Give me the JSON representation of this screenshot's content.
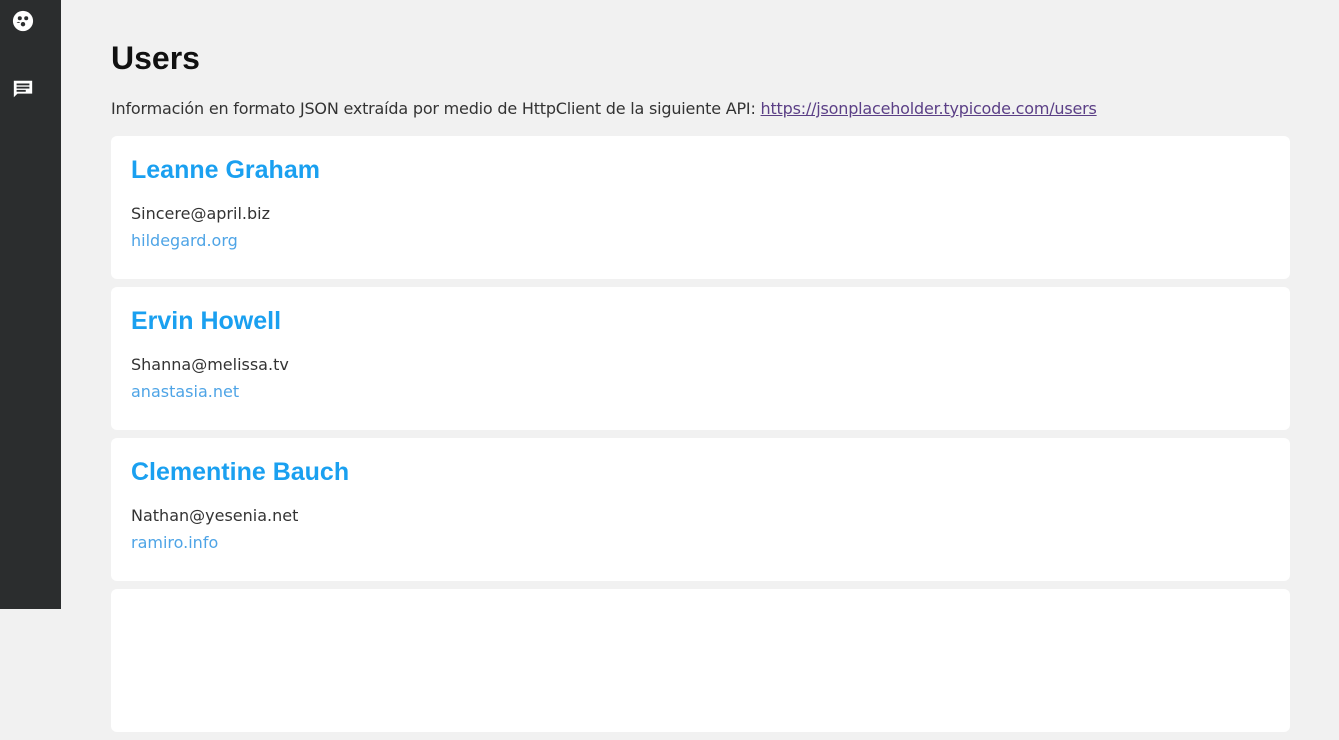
{
  "sidebar": {
    "items": [
      {
        "icon": "users-icon"
      },
      {
        "icon": "message-icon"
      }
    ]
  },
  "header": {
    "title": "Users",
    "intro_text": "Información en formato JSON extraída por medio de HttpClient de la siguiente API: ",
    "api_link": "https://jsonplaceholder.typicode.com/users"
  },
  "users": [
    {
      "name": "Leanne Graham",
      "email": "Sincere@april.biz",
      "website": "hildegard.org"
    },
    {
      "name": "Ervin Howell",
      "email": "Shanna@melissa.tv",
      "website": "anastasia.net"
    },
    {
      "name": "Clementine Bauch",
      "email": "Nathan@yesenia.net",
      "website": "ramiro.info"
    },
    {
      "name": "",
      "email": "",
      "website": ""
    }
  ],
  "colors": {
    "sidebar_bg": "#2b2d2e",
    "page_bg": "#f1f1f1",
    "name_color": "#1aa0f0",
    "website_color": "#4ea4e6",
    "link_color": "#5b3f86"
  }
}
